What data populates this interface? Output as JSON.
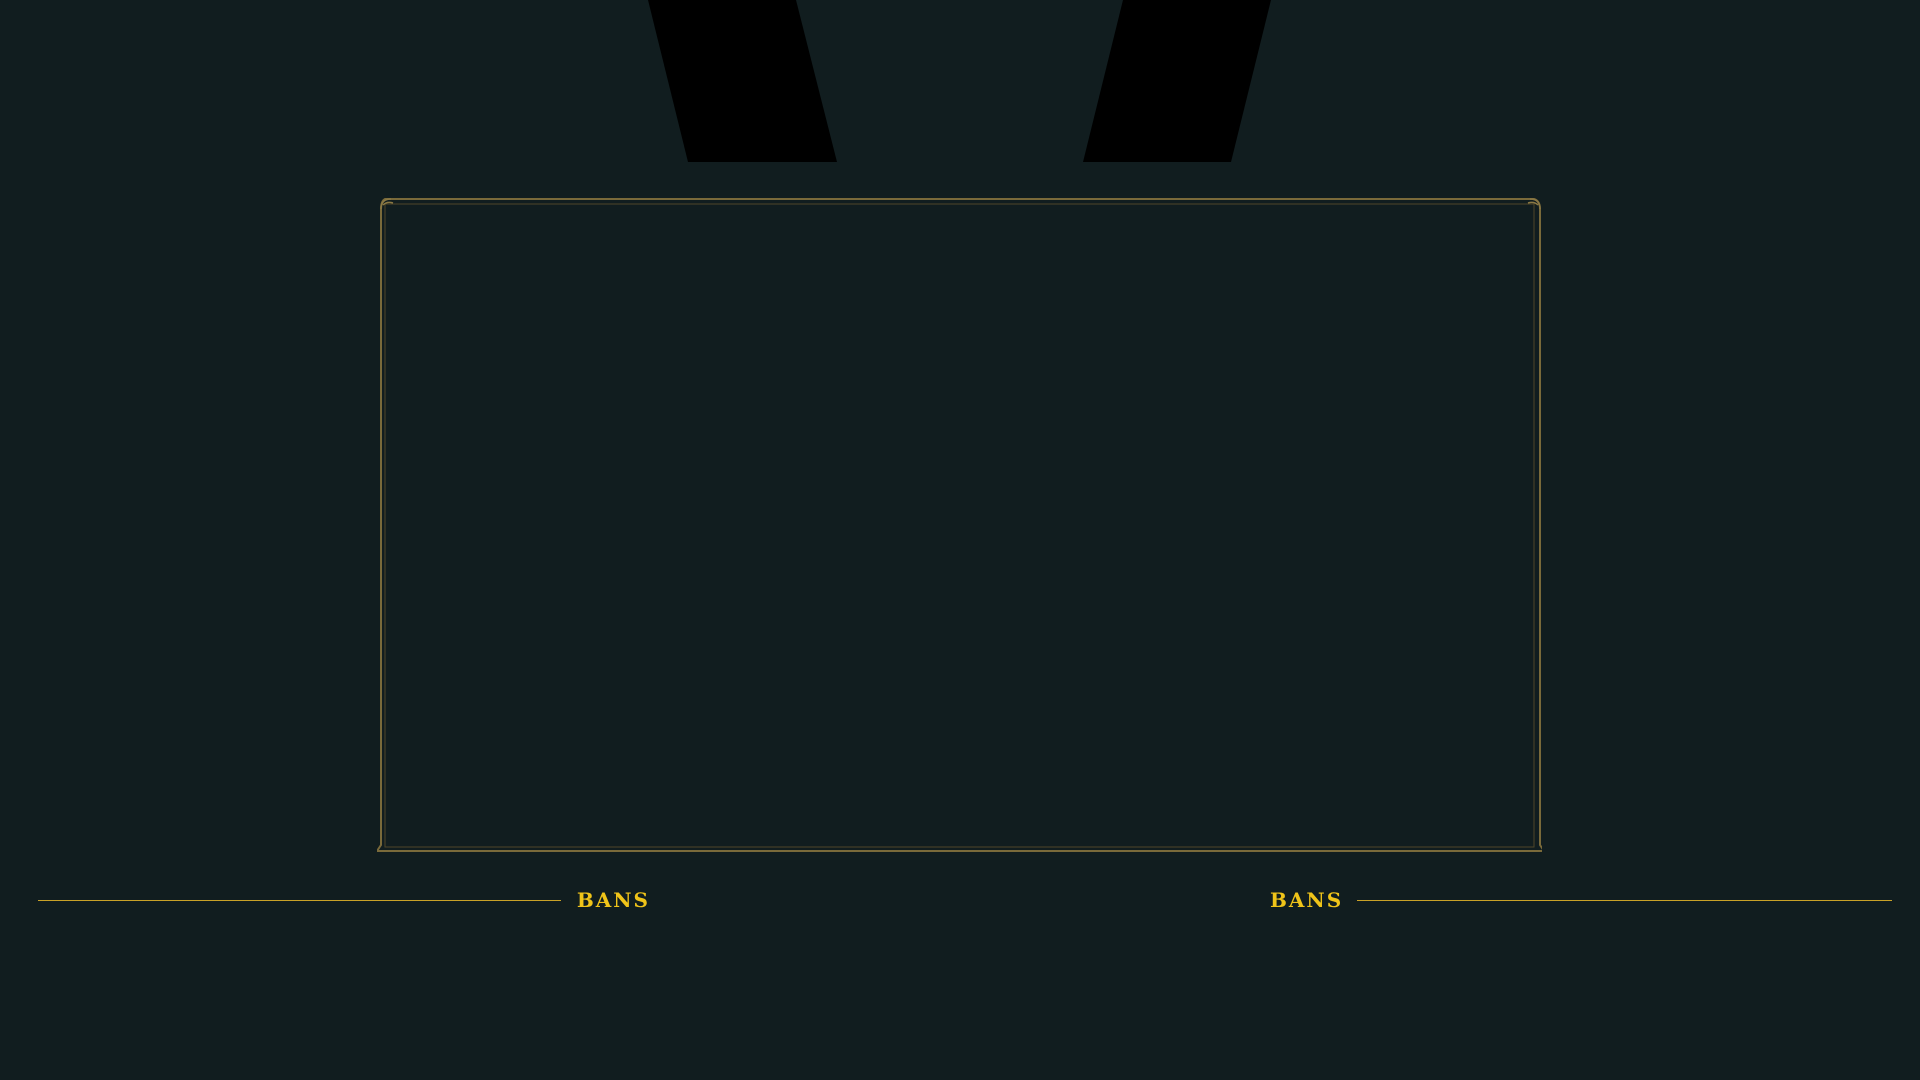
{
  "colors": {
    "background": "#111d1f",
    "frame_border": "#7a6a3a",
    "banner": "#000000",
    "bans_label": "#f0c419",
    "bans_line": "#c9a227"
  },
  "teams": {
    "left": {
      "bans_label": "BANS"
    },
    "right": {
      "bans_label": "BANS"
    }
  }
}
